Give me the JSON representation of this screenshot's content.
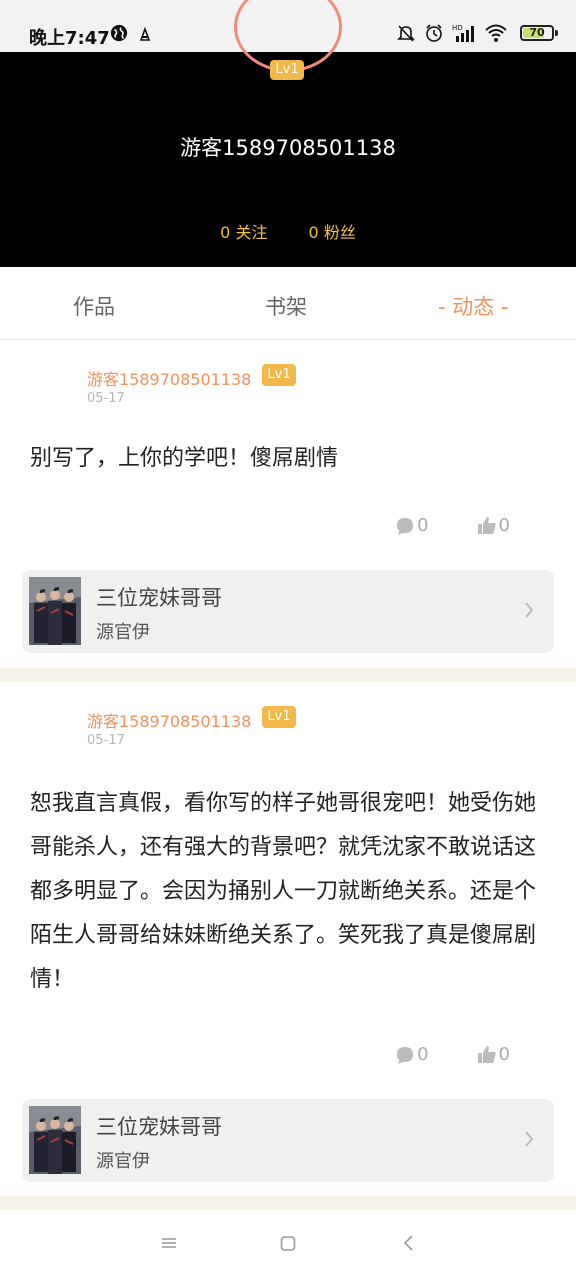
{
  "status_bar": {
    "time": "晚上7:47",
    "battery_level": "70",
    "icons": [
      "globe-icon",
      "app-notification-icon",
      "mute-bell-icon",
      "alarm-icon",
      "cell-signal-icon",
      "wifi-icon",
      "battery-icon"
    ]
  },
  "profile": {
    "level_badge": "Lv1",
    "username": "游客1589708501138",
    "following": "0 关注",
    "followers": "0 粉丝"
  },
  "tabs": [
    {
      "label": "作品",
      "active": false
    },
    {
      "label": "书架",
      "active": false
    },
    {
      "label": "- 动态 -",
      "active": true
    }
  ],
  "colors": {
    "accent": "#f0925a",
    "badge": "#f2b94a",
    "stats_text": "#f2c24a",
    "header_bg": "#000000"
  },
  "posts": [
    {
      "author": "游客1589708501138",
      "level": "Lv1",
      "date": "05-17",
      "text": "别写了，上你的学吧！傻屌剧情",
      "comments": "0",
      "likes": "0",
      "book": {
        "title": "三位宠妹哥哥",
        "author": "源官伊"
      }
    },
    {
      "author": "游客1589708501138",
      "level": "Lv1",
      "date": "05-17",
      "text": "恕我直言真假，看你写的样子她哥很宠吧！她受伤她哥能杀人，还有强大的背景吧？就凭沈家不敢说话这都多明显了。会因为捅别人一刀就断绝关系。还是个陌生人哥哥给妹妹断绝关系了。笑死我了真是傻屌剧情！",
      "comments": "0",
      "likes": "0",
      "book": {
        "title": "三位宠妹哥哥",
        "author": "源官伊"
      }
    }
  ],
  "nav": [
    "menu-icon",
    "home-icon",
    "back-icon"
  ]
}
